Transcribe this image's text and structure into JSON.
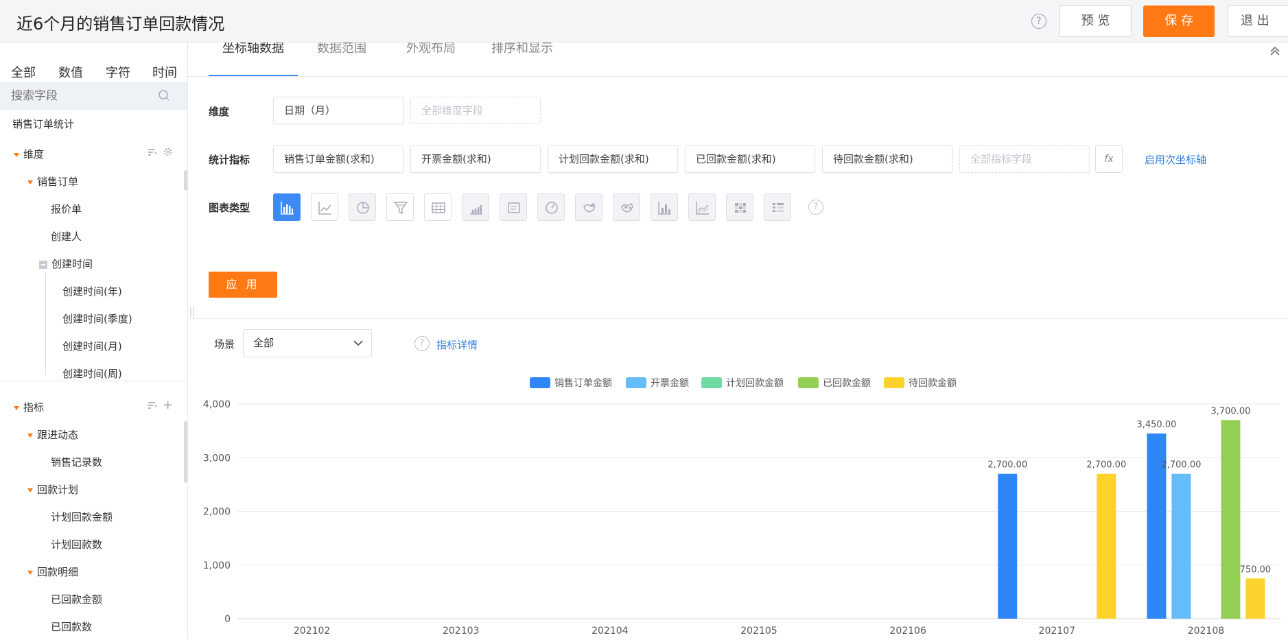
{
  "header": {
    "title": "近6个月的销售订单回款情况",
    "help_icon": "question-circle-icon",
    "preview_label": "预 览",
    "save_label": "保 存",
    "exit_label": "退 出",
    "accent_color": "#ff7a14"
  },
  "sidebar": {
    "tabs": [
      "全部",
      "数值",
      "字符",
      "时间"
    ],
    "search_placeholder": "搜索字段",
    "root_label": "销售订单统计",
    "dimension_label": "维度",
    "dimension_items": [
      {
        "label": "销售订单"
      },
      {
        "label": "报价单"
      },
      {
        "label": "创建人"
      },
      {
        "label": "创建时间"
      },
      {
        "label": "创建时间(年)"
      },
      {
        "label": "创建时间(季度)"
      },
      {
        "label": "创建时间(月)"
      },
      {
        "label": "创建时间(周)"
      }
    ],
    "metric_label": "指标",
    "metric_items": [
      {
        "label": "跟进动态"
      },
      {
        "label": "销售记录数"
      },
      {
        "label": "回款计划"
      },
      {
        "label": "计划回款金额"
      },
      {
        "label": "计划回款数"
      },
      {
        "label": "回款明细"
      },
      {
        "label": "已回款金额"
      },
      {
        "label": "已回款数"
      }
    ]
  },
  "main": {
    "tabs": [
      "坐标轴数据",
      "数据范围",
      "外观布局",
      "排序和显示"
    ],
    "dimension_row_label": "维度",
    "dimension_value": "日期（月）",
    "dimension_placeholder": "全部维度字段",
    "metrics_row_label": "统计指标",
    "metrics": [
      "销售订单金额(求和)",
      "开票金额(求和)",
      "计划回款金额(求和)",
      "已回款金额(求和)",
      "待回款金额(求和)"
    ],
    "metrics_placeholder": "全部指标字段",
    "fx_label": "fx",
    "secondary_axis_link": "启用次坐标轴",
    "chart_type_label": "图表类型",
    "chart_types": [
      "bar-chart-icon",
      "line-chart-icon",
      "pie-chart-icon",
      "funnel-chart-icon",
      "table-chart-icon",
      "area-chart-icon",
      "card-chart-icon",
      "gauge-chart-icon",
      "map-chart-icon",
      "bubble-map-icon",
      "column-chart-icon",
      "stacked-line-icon",
      "heatmap-chart-icon",
      "pivot-table-icon"
    ],
    "apply_label": "应 用",
    "scene_label": "场景",
    "scene_value": "全部",
    "metric_detail_link": "指标详情"
  },
  "chart_data": {
    "type": "bar",
    "categories": [
      "202102",
      "202103",
      "202104",
      "202105",
      "202106",
      "202107",
      "202108"
    ],
    "series": [
      {
        "name": "销售订单金额",
        "color": "#2f86f6",
        "values": [
          0,
          0,
          0,
          0,
          0,
          2700,
          3450
        ]
      },
      {
        "name": "开票金额",
        "color": "#64bdf9",
        "values": [
          0,
          0,
          0,
          0,
          0,
          0,
          2700
        ]
      },
      {
        "name": "计划回款金额",
        "color": "#6fdba3",
        "values": [
          0,
          0,
          0,
          0,
          0,
          0,
          0
        ]
      },
      {
        "name": "已回款金额",
        "color": "#93cf52",
        "values": [
          0,
          0,
          0,
          0,
          0,
          0,
          3700
        ]
      },
      {
        "name": "待回款金额",
        "color": "#fdd22d",
        "values": [
          0,
          0,
          0,
          0,
          0,
          2700,
          750
        ]
      }
    ],
    "data_labels": [
      "2,700.00",
      "2,700.00",
      "3,450.00",
      "2,700.00",
      "3,700.00",
      "750.00"
    ],
    "yticks": [
      "0",
      "1,000",
      "2,000",
      "3,000",
      "4,000"
    ],
    "ylim": [
      0,
      4000
    ],
    "legend_position": "top-center",
    "grid": true
  }
}
